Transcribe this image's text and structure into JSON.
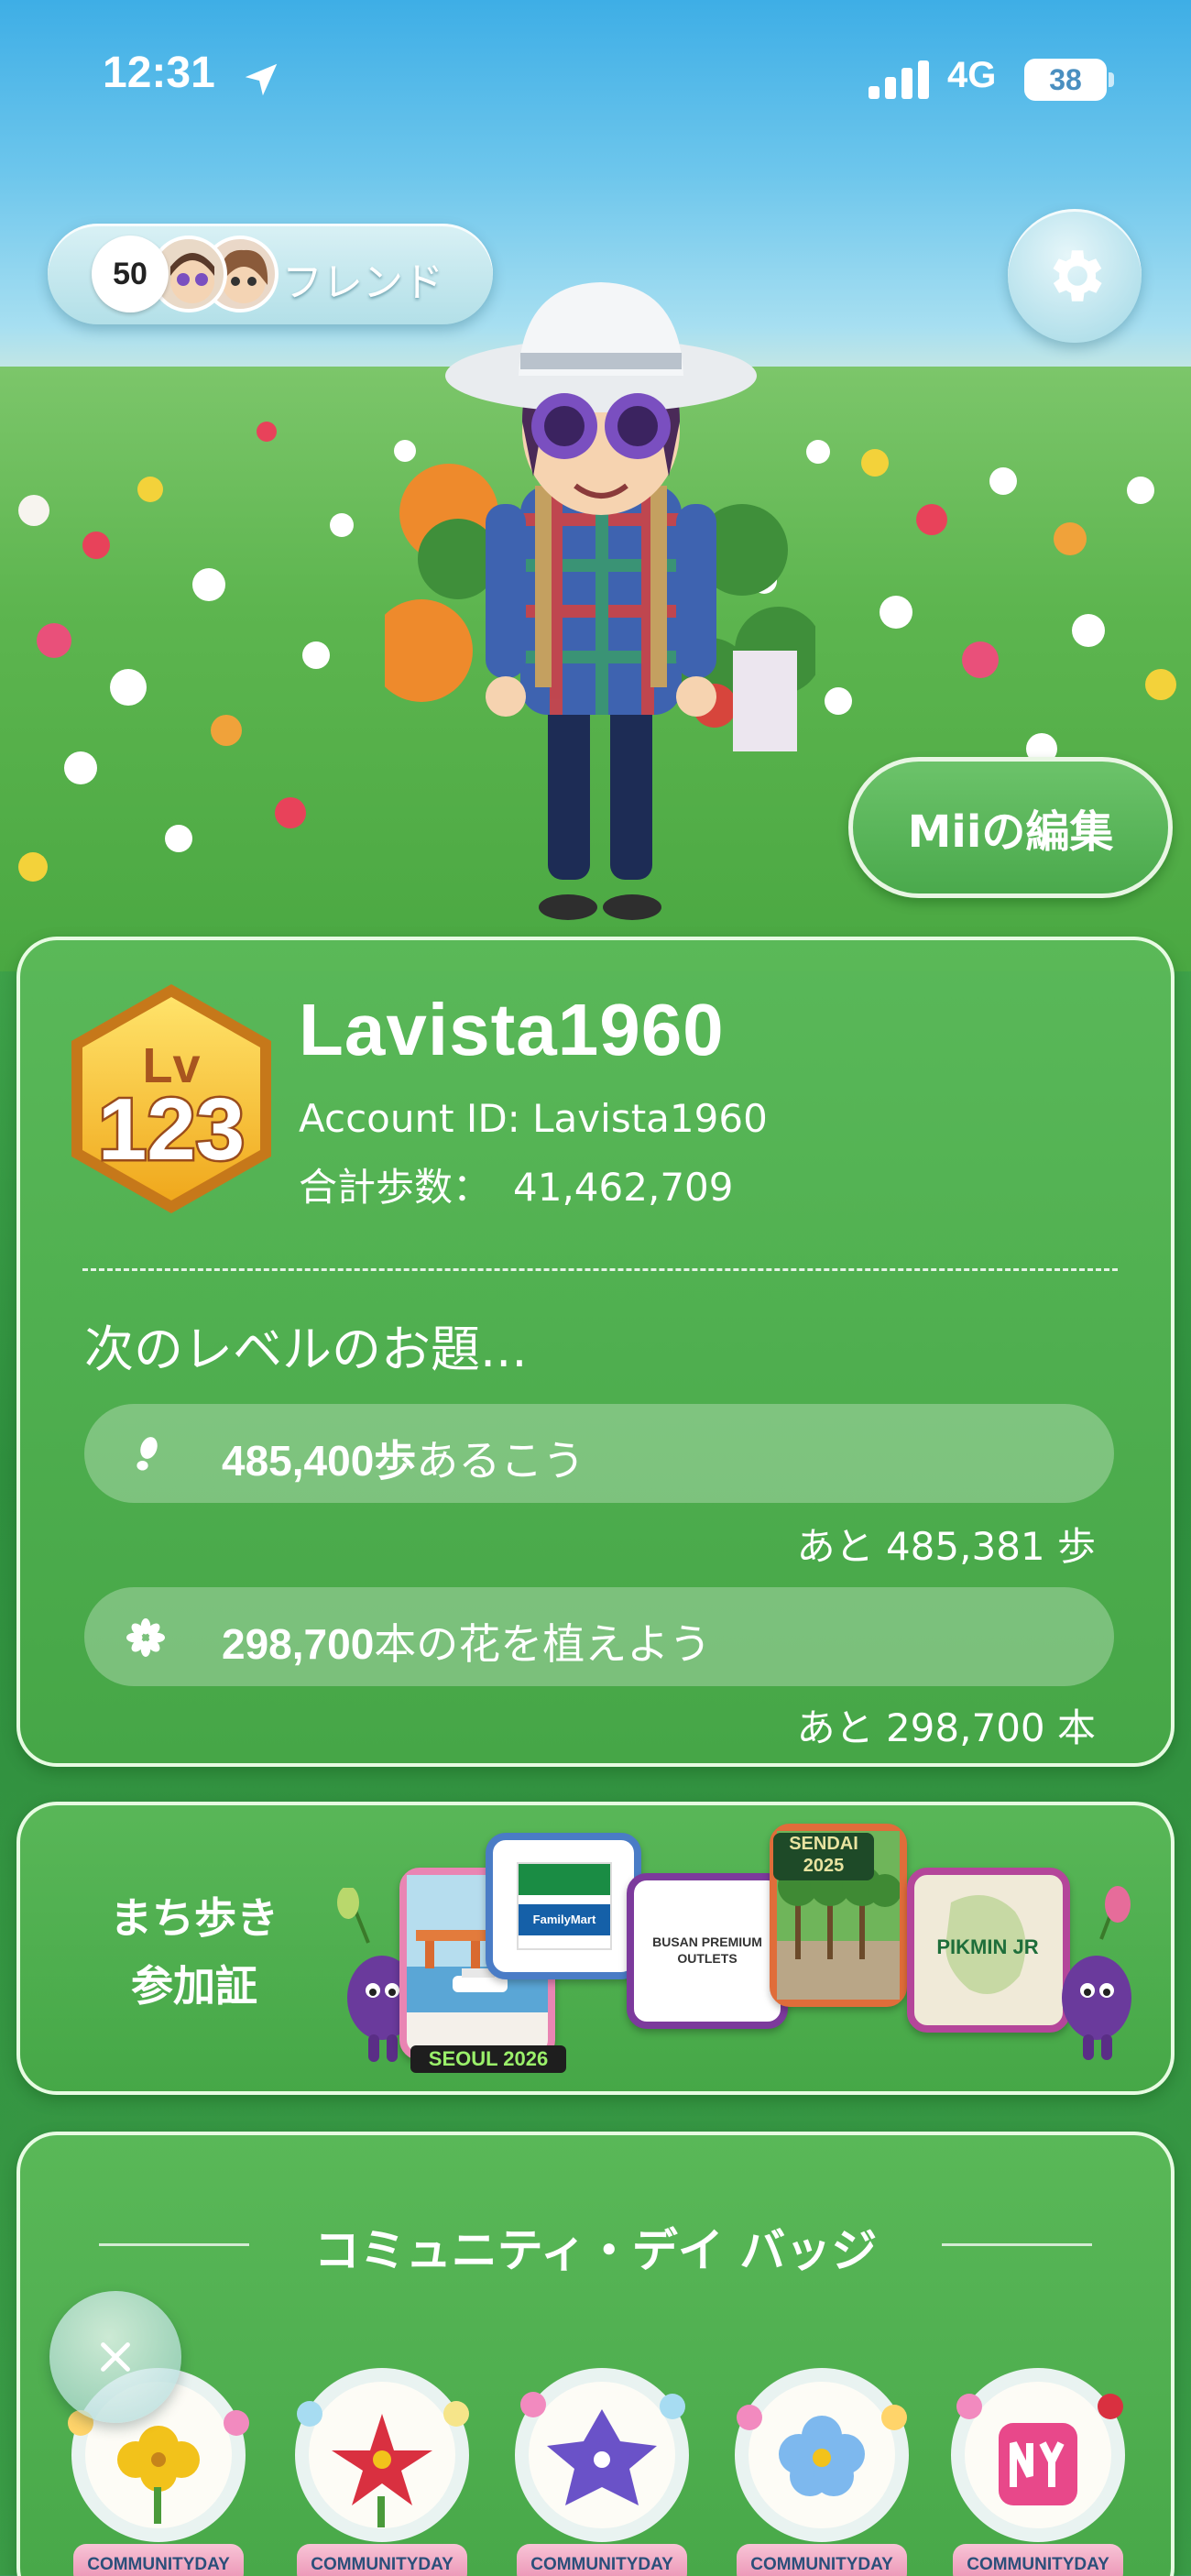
{
  "status_bar": {
    "time": "12:31",
    "network": "4G",
    "battery": "38"
  },
  "friends": {
    "count": "50",
    "label": "フレンド"
  },
  "edit_mii_label": "Miiの編集",
  "profile": {
    "level_prefix": "Lv",
    "level": "123",
    "username": "Lavista1960",
    "account_id": "Account ID: Lavista1960",
    "total_steps_label": "合計歩数：",
    "total_steps_value": "41,462,709"
  },
  "next_level": {
    "title": "次のレベルのお題...",
    "tasks": [
      {
        "icon": "footprint-icon",
        "amount": "485,400歩",
        "text": "あるこう",
        "remaining": "あと 485,381 歩"
      },
      {
        "icon": "flower-icon",
        "amount": "298,700",
        "text": "本の花を植えよう",
        "remaining": "あと 298,700 本"
      }
    ]
  },
  "walk_card": {
    "title_line1": "まち歩き",
    "title_line2": "参加証",
    "patches": [
      {
        "name": "seoul-patch",
        "text": "SEOUL 2026"
      },
      {
        "name": "familymart-patch",
        "text": "FamilyMart"
      },
      {
        "name": "busan-patch",
        "text": "BUSAN PREMIUM OUTLETS"
      },
      {
        "name": "sendai-patch",
        "text": "SENDAI 2025"
      },
      {
        "name": "pikmin-jr-patch",
        "text": "PIKMIN JR"
      }
    ]
  },
  "community": {
    "title": "コミュニティ・デイ バッジ",
    "badges": [
      {
        "label": "COMMUNITYDAY",
        "flower_color": "#f2c21b"
      },
      {
        "label": "COMMUNITYDAY",
        "flower_color": "#d93040"
      },
      {
        "label": "COMMUNITYDAY",
        "flower_color": "#6a52c8"
      },
      {
        "label": "COMMUNITYDAY",
        "flower_color": "#7db8ee"
      },
      {
        "label": "COMMUNITYDAY",
        "flower_color": "#e8488a"
      }
    ]
  },
  "colors": {
    "card_green": "#55b254",
    "level_gold": "#f4b826",
    "sky_blue": "#4fb2e6"
  }
}
